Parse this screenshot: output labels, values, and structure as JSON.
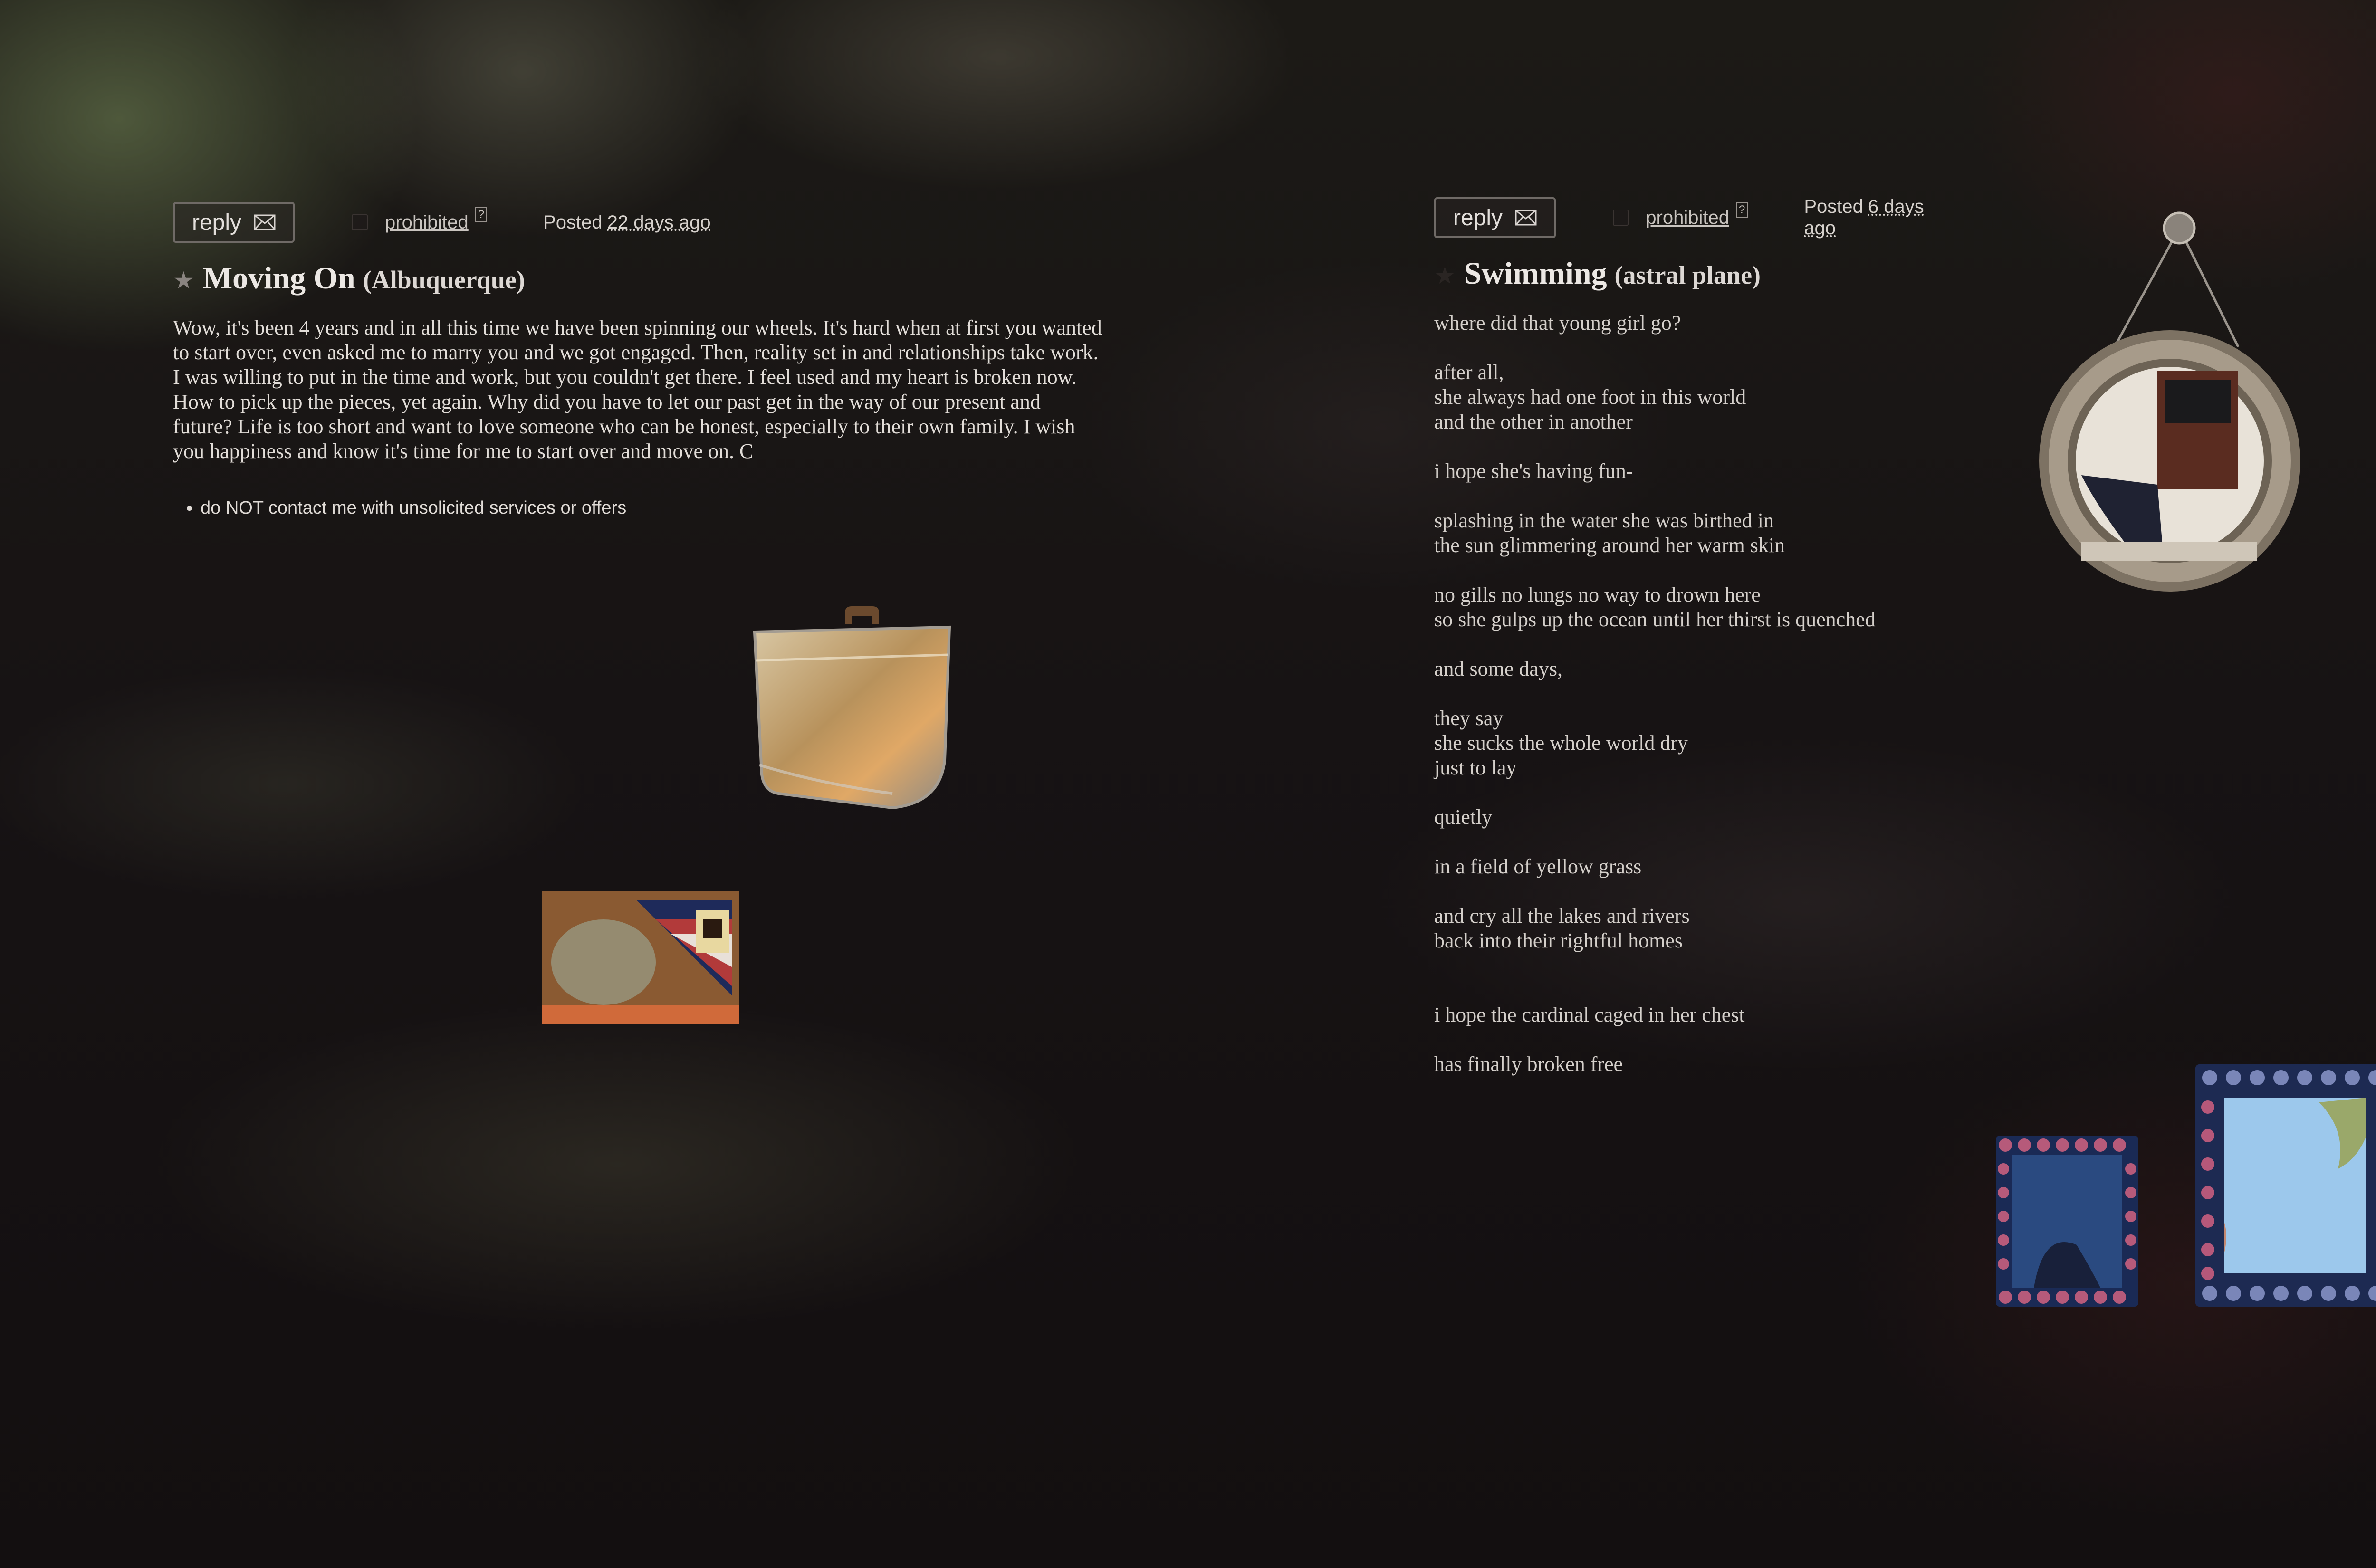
{
  "left_post": {
    "reply_label": "reply",
    "prohibited_label": "prohibited",
    "help_mark": "?",
    "posted_label": "Posted",
    "posted_time": "22 days ago",
    "title": "Moving On",
    "location": "(Albuquerque)",
    "body": "Wow, it's been 4 years and in all this time we have been spinning our wheels. It's hard when at first you wanted to start over, even asked me to marry you and we got engaged. Then, reality set in and relationships take work. I was willing to put in the time and work, but you couldn't get there. I feel used and my heart is broken now. How to pick up the pieces, yet again. Why did you have to let our past get in the way of our present and future? Life is too short and want to love someone who can be honest, especially to their own family. I wish you happiness and know it's time for me to start over and move on. C",
    "notices": [
      "do NOT contact me with unsolicited services or offers"
    ]
  },
  "right_post": {
    "reply_label": "reply",
    "prohibited_label": "prohibited",
    "help_mark": "?",
    "posted_label": "Posted",
    "posted_time": "6 days ago",
    "title": "Swimming",
    "location": "(astral plane)",
    "stanzas": [
      "where did that young girl go?",
      "after all,\nshe always had one foot in this world\nand the other in another",
      "i hope she's having fun-",
      "splashing in the water she was birthed in\nthe sun glimmering around her warm skin",
      "no gills no lungs no way to drown here\nso she gulps up the ocean until her thirst is quenched",
      "and some days,",
      "they say\nshe sucks the whole world dry\njust to lay",
      "quietly",
      "in a field of yellow grass",
      "and cry all the lakes and rivers\nback into their rightful homes",
      "i hope the cardinal caged in her chest",
      "has finally broken free"
    ]
  },
  "icons": {
    "mail": "mail-icon",
    "star": "star-icon"
  },
  "colors": {
    "background": "#141011",
    "text": "#e2ddd8"
  }
}
